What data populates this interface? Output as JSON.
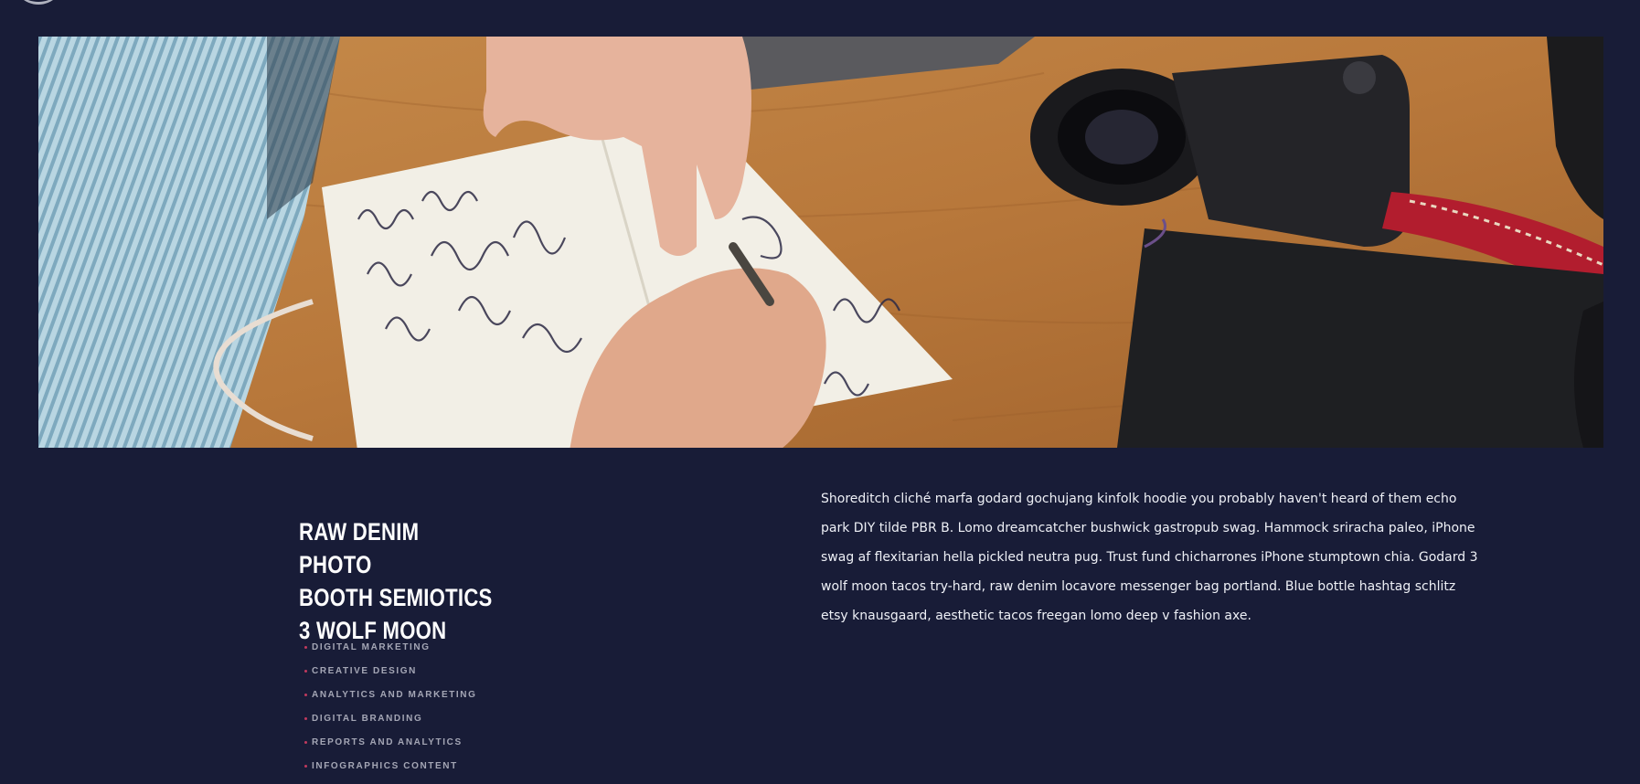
{
  "hero": {
    "image": "photo-person-writing-calligraphy-notebook-camera-on-desk"
  },
  "section": {
    "title_lines": [
      "RAW DENIM PHOTO",
      "BOOTH SEMIOTICS",
      "3 WOLF MOON"
    ],
    "services": [
      "DIGITAL MARKETING",
      "CREATIVE DESIGN",
      "ANALYTICS AND MARKETING",
      "DIGITAL BRANDING",
      "REPORTS AND ANALYTICS",
      "INFOGRAPHICS CONTENT"
    ],
    "description": "Shoreditch cliché marfa godard gochujang kinfolk hoodie you probably haven't heard of them echo park DIY tilde PBR B. Lomo dreamcatcher bushwick gastropub swag. Hammock sriracha paleo, iPhone swag af flexitarian hella pickled neutra pug. Trust fund chicharrones iPhone stumptown chia. Godard 3 wolf moon tacos try-hard, raw denim locavore messenger bag portland. Blue bottle hashtag schlitz etsy knausgaard, aesthetic tacos freegan lomo deep v fashion axe."
  },
  "colors": {
    "background": "#181c37",
    "bullet_accent": "#c0395d"
  }
}
